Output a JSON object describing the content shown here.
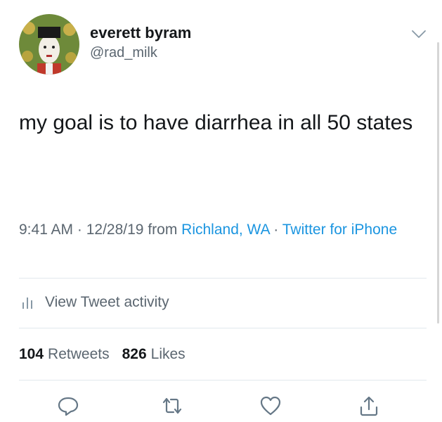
{
  "author": {
    "display_name": "everett byram",
    "handle": "@rad_milk"
  },
  "tweet": {
    "text": "my goal is to have diarrhea in all 50 states"
  },
  "meta": {
    "time": "9:41 AM",
    "separator": " · ",
    "date": "12/28/19",
    "from_label": " from ",
    "location": "Richland, WA",
    "source": "Twitter for iPhone"
  },
  "activity": {
    "label": "View Tweet activity"
  },
  "stats": {
    "retweets_count": "104",
    "retweets_label": "Retweets",
    "likes_count": "826",
    "likes_label": "Likes"
  },
  "icons": {
    "reply": "reply-icon",
    "retweet": "retweet-icon",
    "like": "heart-icon",
    "share": "share-icon",
    "more": "chevron-down-icon",
    "activity": "bar-chart-icon"
  },
  "colors": {
    "link": "#1b95e0",
    "secondary_text": "#5b6670",
    "primary_text": "#14171a",
    "divider": "#e1e8ed"
  }
}
